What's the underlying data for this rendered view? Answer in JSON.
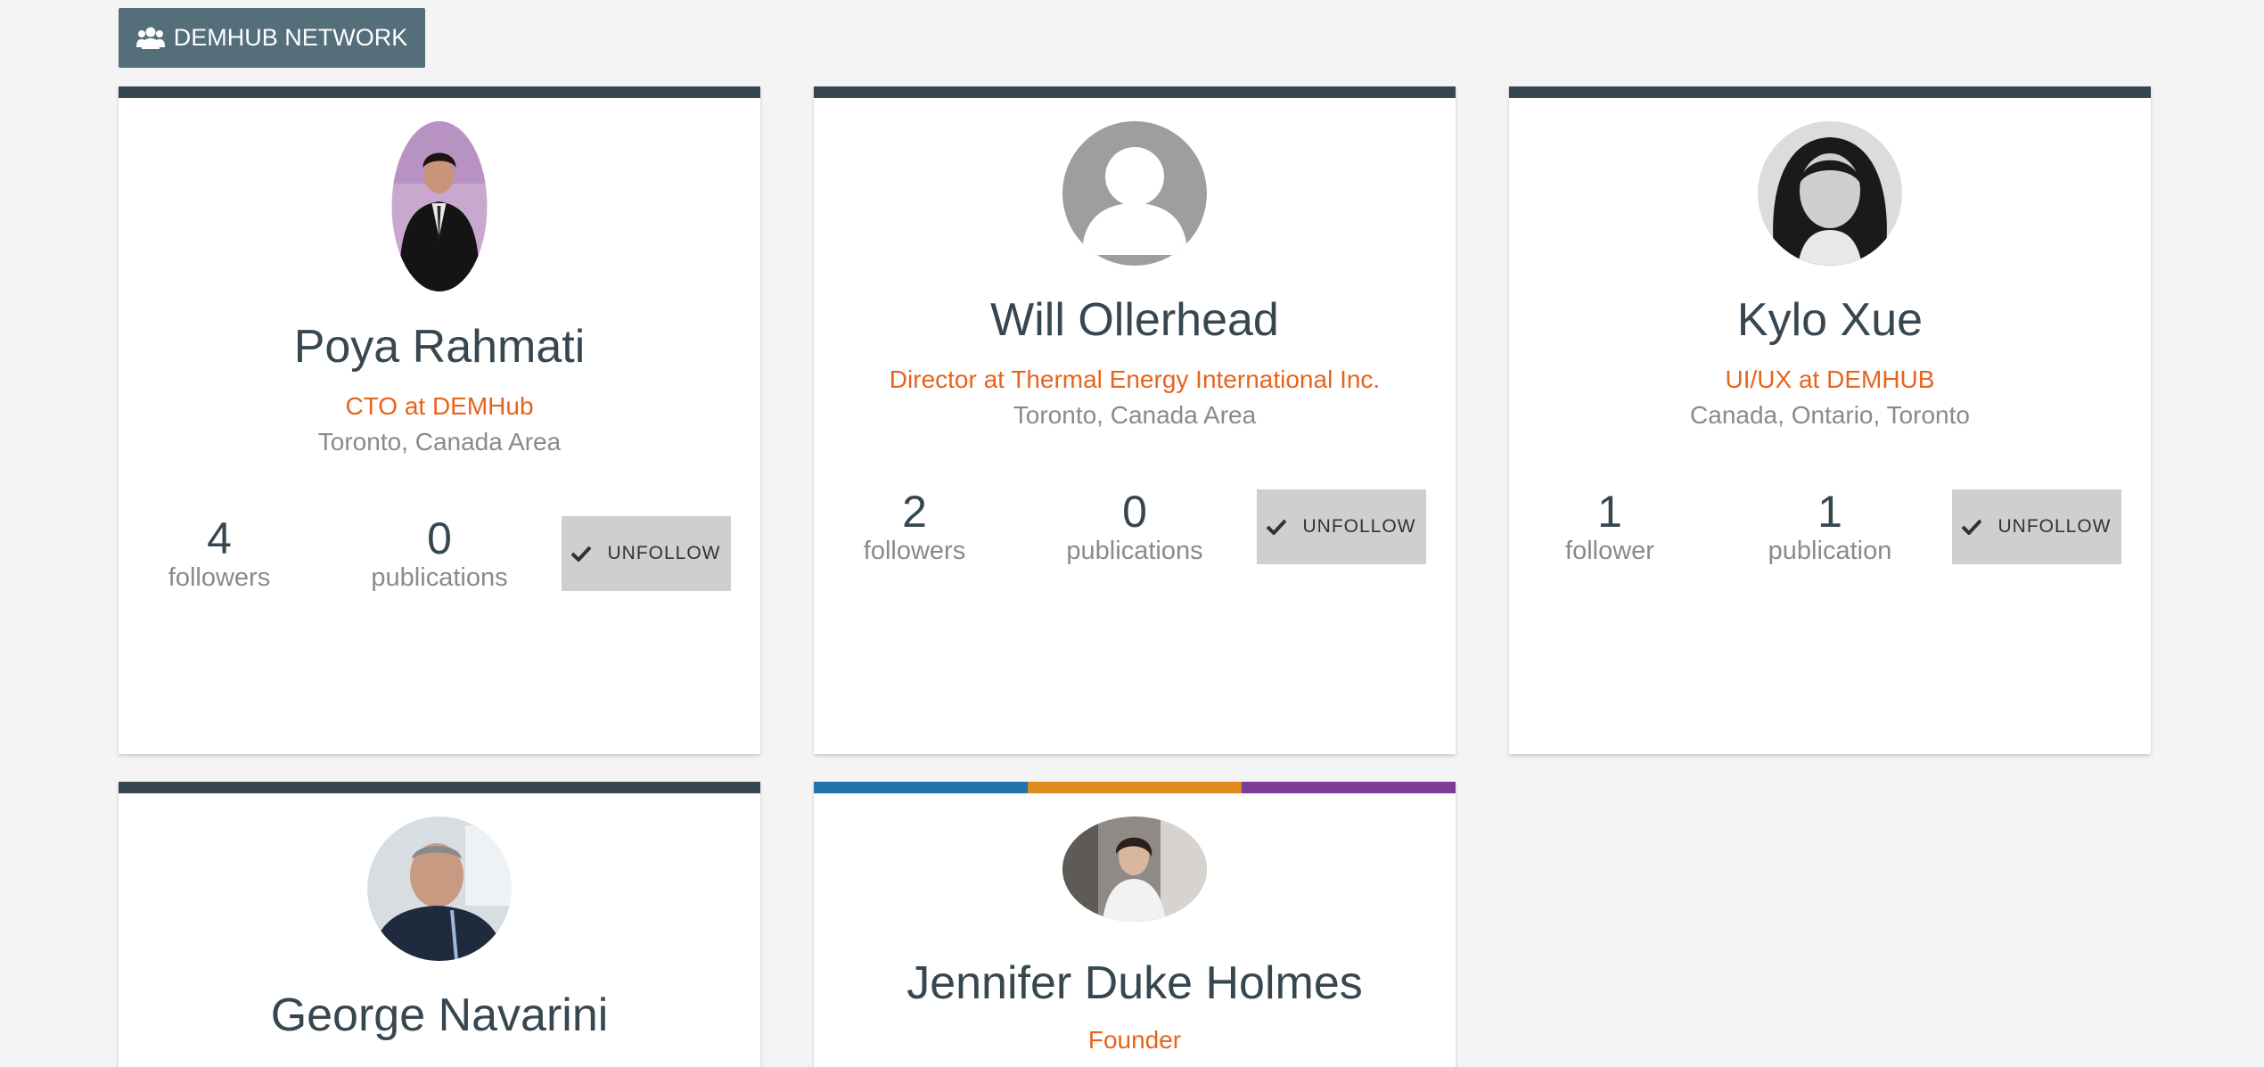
{
  "header": {
    "network_button_label": "DEMHUB NETWORK",
    "network_icon": "users-icon"
  },
  "colors": {
    "card_topbar": "#37474f",
    "accent": "#e8631c",
    "network_button": "#546e7a",
    "unfollow_button": "#cfcfcf",
    "multi_topbar": [
      "#1f76a8",
      "#e08a1e",
      "#7d3d97"
    ]
  },
  "cards": [
    {
      "name": "Poya Rahmati",
      "role": "CTO at DEMHub",
      "location": "Toronto, Canada Area",
      "followers_count": "4",
      "followers_label": "followers",
      "publications_count": "0",
      "publications_label": "publications",
      "button_label": "UNFOLLOW",
      "avatar": "photo"
    },
    {
      "name": "Will Ollerhead",
      "role": "Director at Thermal Energy International Inc.",
      "location": "Toronto, Canada Area",
      "followers_count": "2",
      "followers_label": "followers",
      "publications_count": "0",
      "publications_label": "publications",
      "button_label": "UNFOLLOW",
      "avatar": "default-user-icon"
    },
    {
      "name": "Kylo Xue",
      "role": "UI/UX at DEMHUB",
      "location": "Canada, Ontario, Toronto",
      "followers_count": "1",
      "followers_label": "follower",
      "publications_count": "1",
      "publications_label": "publication",
      "button_label": "UNFOLLOW",
      "avatar": "photo"
    },
    {
      "name": "George Navarini",
      "avatar": "photo"
    },
    {
      "name": "Jennifer Duke Holmes",
      "role": "Founder",
      "avatar": "photo"
    }
  ]
}
